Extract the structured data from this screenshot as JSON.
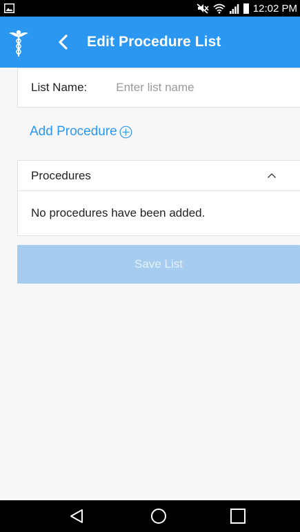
{
  "status_bar": {
    "time": "12:02 PM",
    "icons": [
      "image-icon",
      "mute-icon",
      "wifi-icon",
      "signal-icon",
      "battery-icon"
    ]
  },
  "app_bar": {
    "title": "Edit Procedure List",
    "logo_icon": "caduceus-icon",
    "back_icon": "chevron-left-icon",
    "color": "#2b97f0"
  },
  "list_name": {
    "label": "List Name:",
    "placeholder": "Enter list name",
    "value": ""
  },
  "add_procedure": {
    "label": "Add Procedure",
    "icon": "plus-circle-icon",
    "color": "#2b97f0"
  },
  "procedures": {
    "title": "Procedures",
    "toggle_icon": "chevron-up-icon",
    "empty_message": "No procedures have been added."
  },
  "save_button": {
    "label": "Save List",
    "color": "#a6cdef"
  },
  "nav_bar": {
    "icons": [
      "back-triangle-icon",
      "home-circle-icon",
      "recents-square-icon"
    ]
  }
}
